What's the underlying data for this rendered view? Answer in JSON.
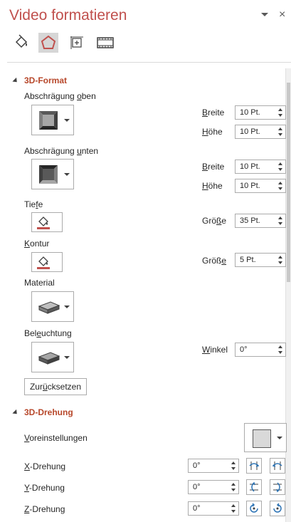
{
  "panel": {
    "title": "Video formatieren",
    "tabs": [
      {
        "name": "fill-line-icon"
      },
      {
        "name": "effects-pentagon-icon"
      },
      {
        "name": "size-properties-icon"
      },
      {
        "name": "video-icon"
      }
    ]
  },
  "format3d": {
    "heading": "3D-Format",
    "bevel_top": {
      "pre": "Abschrägung ",
      "u": "o",
      "post": "ben"
    },
    "bevel_bottom": {
      "pre": "Abschrägung ",
      "u": "u",
      "post": "nten"
    },
    "width_label": {
      "pre": "",
      "u": "B",
      "post": "reite"
    },
    "height_label": {
      "pre": "",
      "u": "H",
      "post": "öhe"
    },
    "bevel_top_width": "10 Pt.",
    "bevel_top_height": "10 Pt.",
    "bevel_bottom_width": "10 Pt.",
    "bevel_bottom_height": "10 Pt.",
    "depth": {
      "pre": "Tie",
      "u": "f",
      "post": "e"
    },
    "depth_size_label": {
      "pre": "Grö",
      "u": "ß",
      "post": "e"
    },
    "depth_size": "35 Pt.",
    "contour": {
      "pre": "",
      "u": "K",
      "post": "ontur"
    },
    "contour_size_label": {
      "pre": "Größ",
      "u": "e",
      "post": ""
    },
    "contour_size": "5 Pt.",
    "material": "Material",
    "lighting": {
      "pre": "Bel",
      "u": "e",
      "post": "uchtung"
    },
    "angle_label": {
      "pre": "",
      "u": "W",
      "post": "inkel"
    },
    "angle": "0°",
    "reset": {
      "pre": "Zur",
      "u": "ü",
      "post": "cksetzen"
    },
    "accent_color": "#c0504d"
  },
  "rotation3d": {
    "heading": "3D-Drehung",
    "presets": {
      "pre": "",
      "u": "V",
      "post": "oreinstellungen"
    },
    "x_label": {
      "pre": "",
      "u": "X",
      "post": "-Drehung"
    },
    "x_value": "0°",
    "y_label": {
      "pre": "",
      "u": "Y",
      "post": "-Drehung"
    },
    "y_value": "0°",
    "z_label": {
      "pre": "",
      "u": "Z",
      "post": "-Drehung"
    },
    "z_value": "0°"
  }
}
